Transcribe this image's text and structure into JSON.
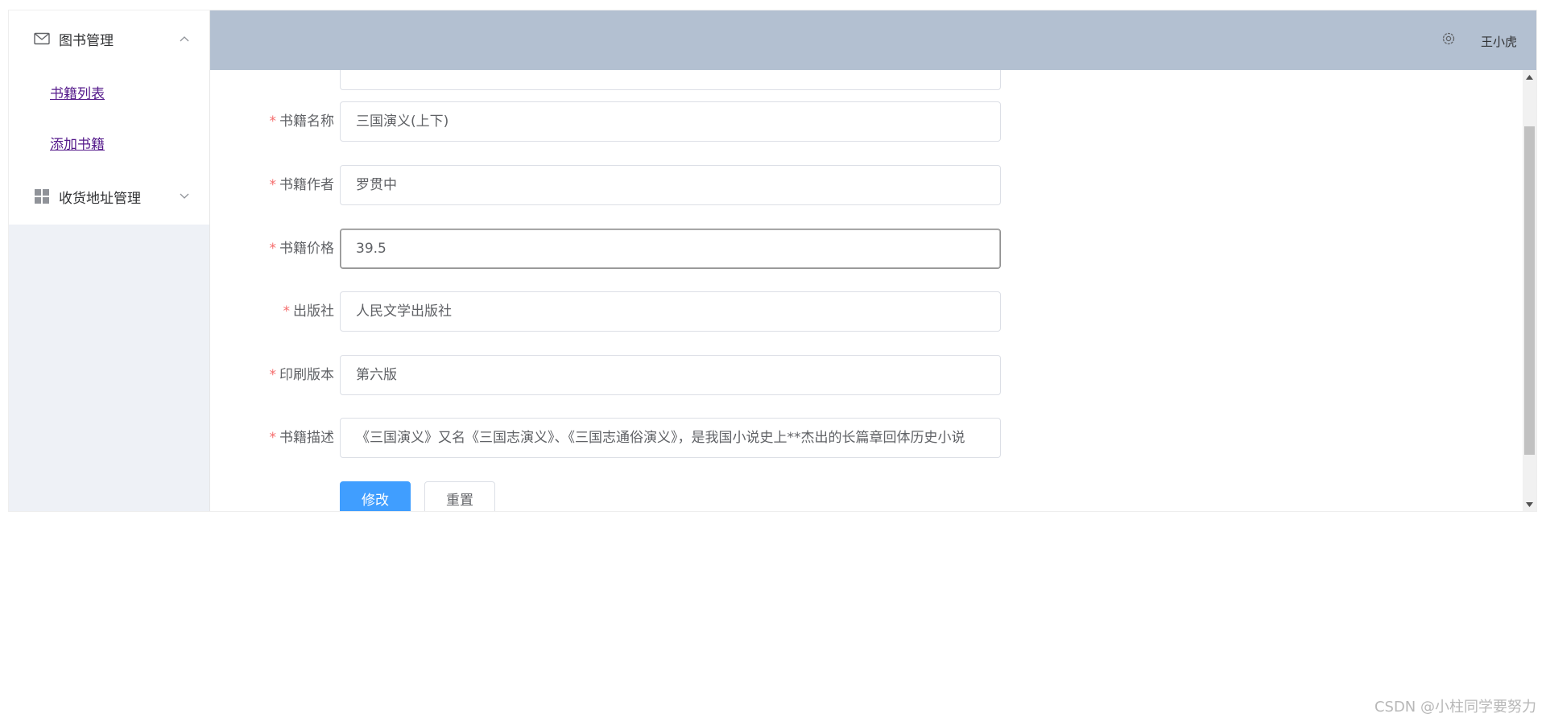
{
  "sidebar": {
    "menus": [
      {
        "title": "图书管理",
        "icon": "envelope-icon",
        "expanded": true,
        "items": [
          {
            "label": "书籍列表"
          },
          {
            "label": "添加书籍"
          }
        ]
      },
      {
        "title": "收货地址管理",
        "icon": "grid-icon",
        "expanded": false,
        "items": []
      }
    ]
  },
  "header": {
    "settings_icon": "gear-icon",
    "username": "王小虎"
  },
  "form": {
    "fields": [
      {
        "label": "书籍名称",
        "required": true,
        "value": "三国演义(上下)"
      },
      {
        "label": "书籍作者",
        "required": true,
        "value": "罗贯中"
      },
      {
        "label": "书籍价格",
        "required": true,
        "value": "39.5",
        "focused": true
      },
      {
        "label": "出版社",
        "required": true,
        "value": "人民文学出版社"
      },
      {
        "label": "印刷版本",
        "required": true,
        "value": "第六版"
      },
      {
        "label": "书籍描述",
        "required": true,
        "value": "《三国演义》又名《三国志演义》、《三国志通俗演义》，是我国小说史上**杰出的长篇章回体历史小说"
      }
    ],
    "required_mark": "*",
    "submit_label": "修改",
    "reset_label": "重置"
  },
  "colors": {
    "header_bg": "#b3c0d1",
    "sidebar_bg": "#eef1f6",
    "primary": "#409eff",
    "required": "#f56c6c"
  },
  "watermark": "CSDN @小柱同学要努力"
}
